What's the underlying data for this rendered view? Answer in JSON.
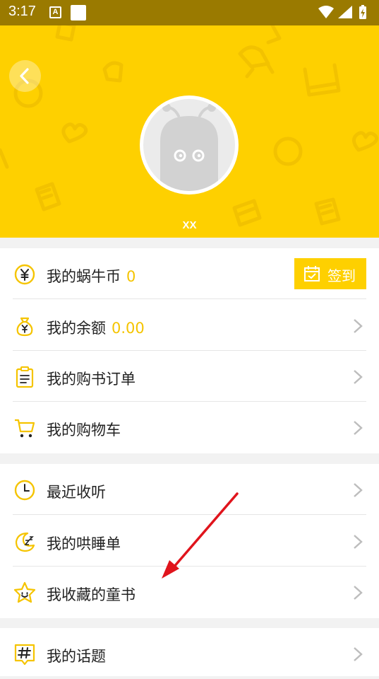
{
  "status_bar": {
    "time": "3:17",
    "notification_icon_letter": "A",
    "icons": [
      "notification-a-icon",
      "sim-card-icon",
      "wifi-icon",
      "signal-icon",
      "battery-icon"
    ]
  },
  "header": {
    "username": "XX",
    "carousel": {
      "page_count": 2,
      "active_page": 1
    },
    "background_color": "#fed000"
  },
  "menu": {
    "coins": {
      "label": "我的蜗牛币",
      "value": "0",
      "checkin_label": "签到",
      "icon": "yen-coin-icon"
    },
    "balance": {
      "label": "我的余额",
      "value": "0.00",
      "icon": "money-bag-icon"
    },
    "book_orders": {
      "label": "我的购书订单",
      "icon": "clipboard-icon"
    },
    "cart": {
      "label": "我的购物车",
      "icon": "shopping-cart-icon"
    },
    "recent": {
      "label": "最近收听",
      "icon": "clock-icon"
    },
    "sleep_list": {
      "label": "我的哄睡单",
      "icon": "moon-zzz-icon"
    },
    "favorite_books": {
      "label": "我收藏的童书",
      "icon": "star-icon"
    },
    "topics": {
      "label": "我的话题",
      "icon": "hashtag-icon"
    }
  },
  "colors": {
    "accent": "#fed000",
    "value_text": "#f5c400",
    "annotation_arrow": "#e0141c"
  }
}
